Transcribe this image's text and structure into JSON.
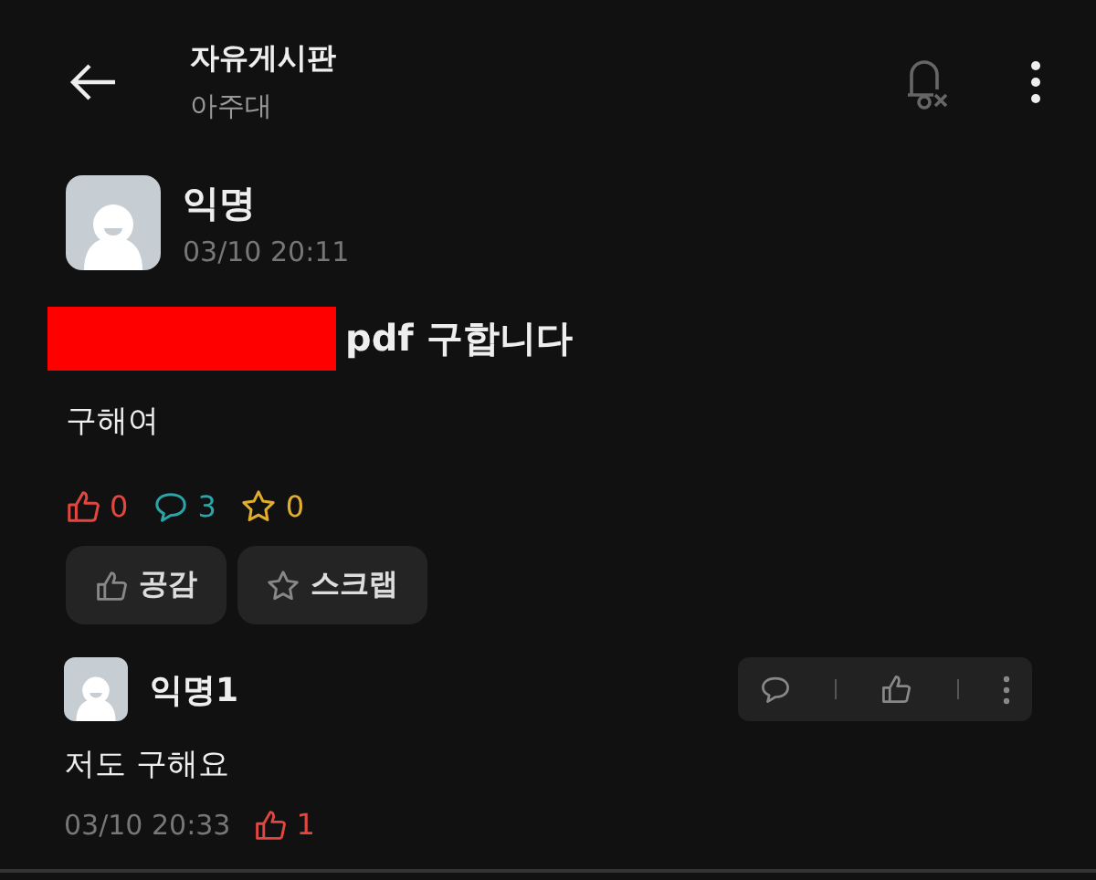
{
  "header": {
    "title": "자유게시판",
    "subtitle": "아주대"
  },
  "post": {
    "author": "익명",
    "time": "03/10 20:11",
    "title": {
      "redacted": true,
      "text": "pdf 구합니다"
    },
    "body": "구해여",
    "counts": [
      {
        "kind": "like",
        "value": "0"
      },
      {
        "kind": "comment",
        "value": "3"
      },
      {
        "kind": "scrap",
        "value": "0"
      }
    ],
    "buttons": [
      {
        "kind": "like",
        "label": "공감"
      },
      {
        "kind": "scrap",
        "label": "스크랩"
      }
    ]
  },
  "comments": [
    {
      "author": "익명1",
      "text": "저도 구해요",
      "time": "03/10 20:33",
      "likes": "1"
    }
  ]
}
